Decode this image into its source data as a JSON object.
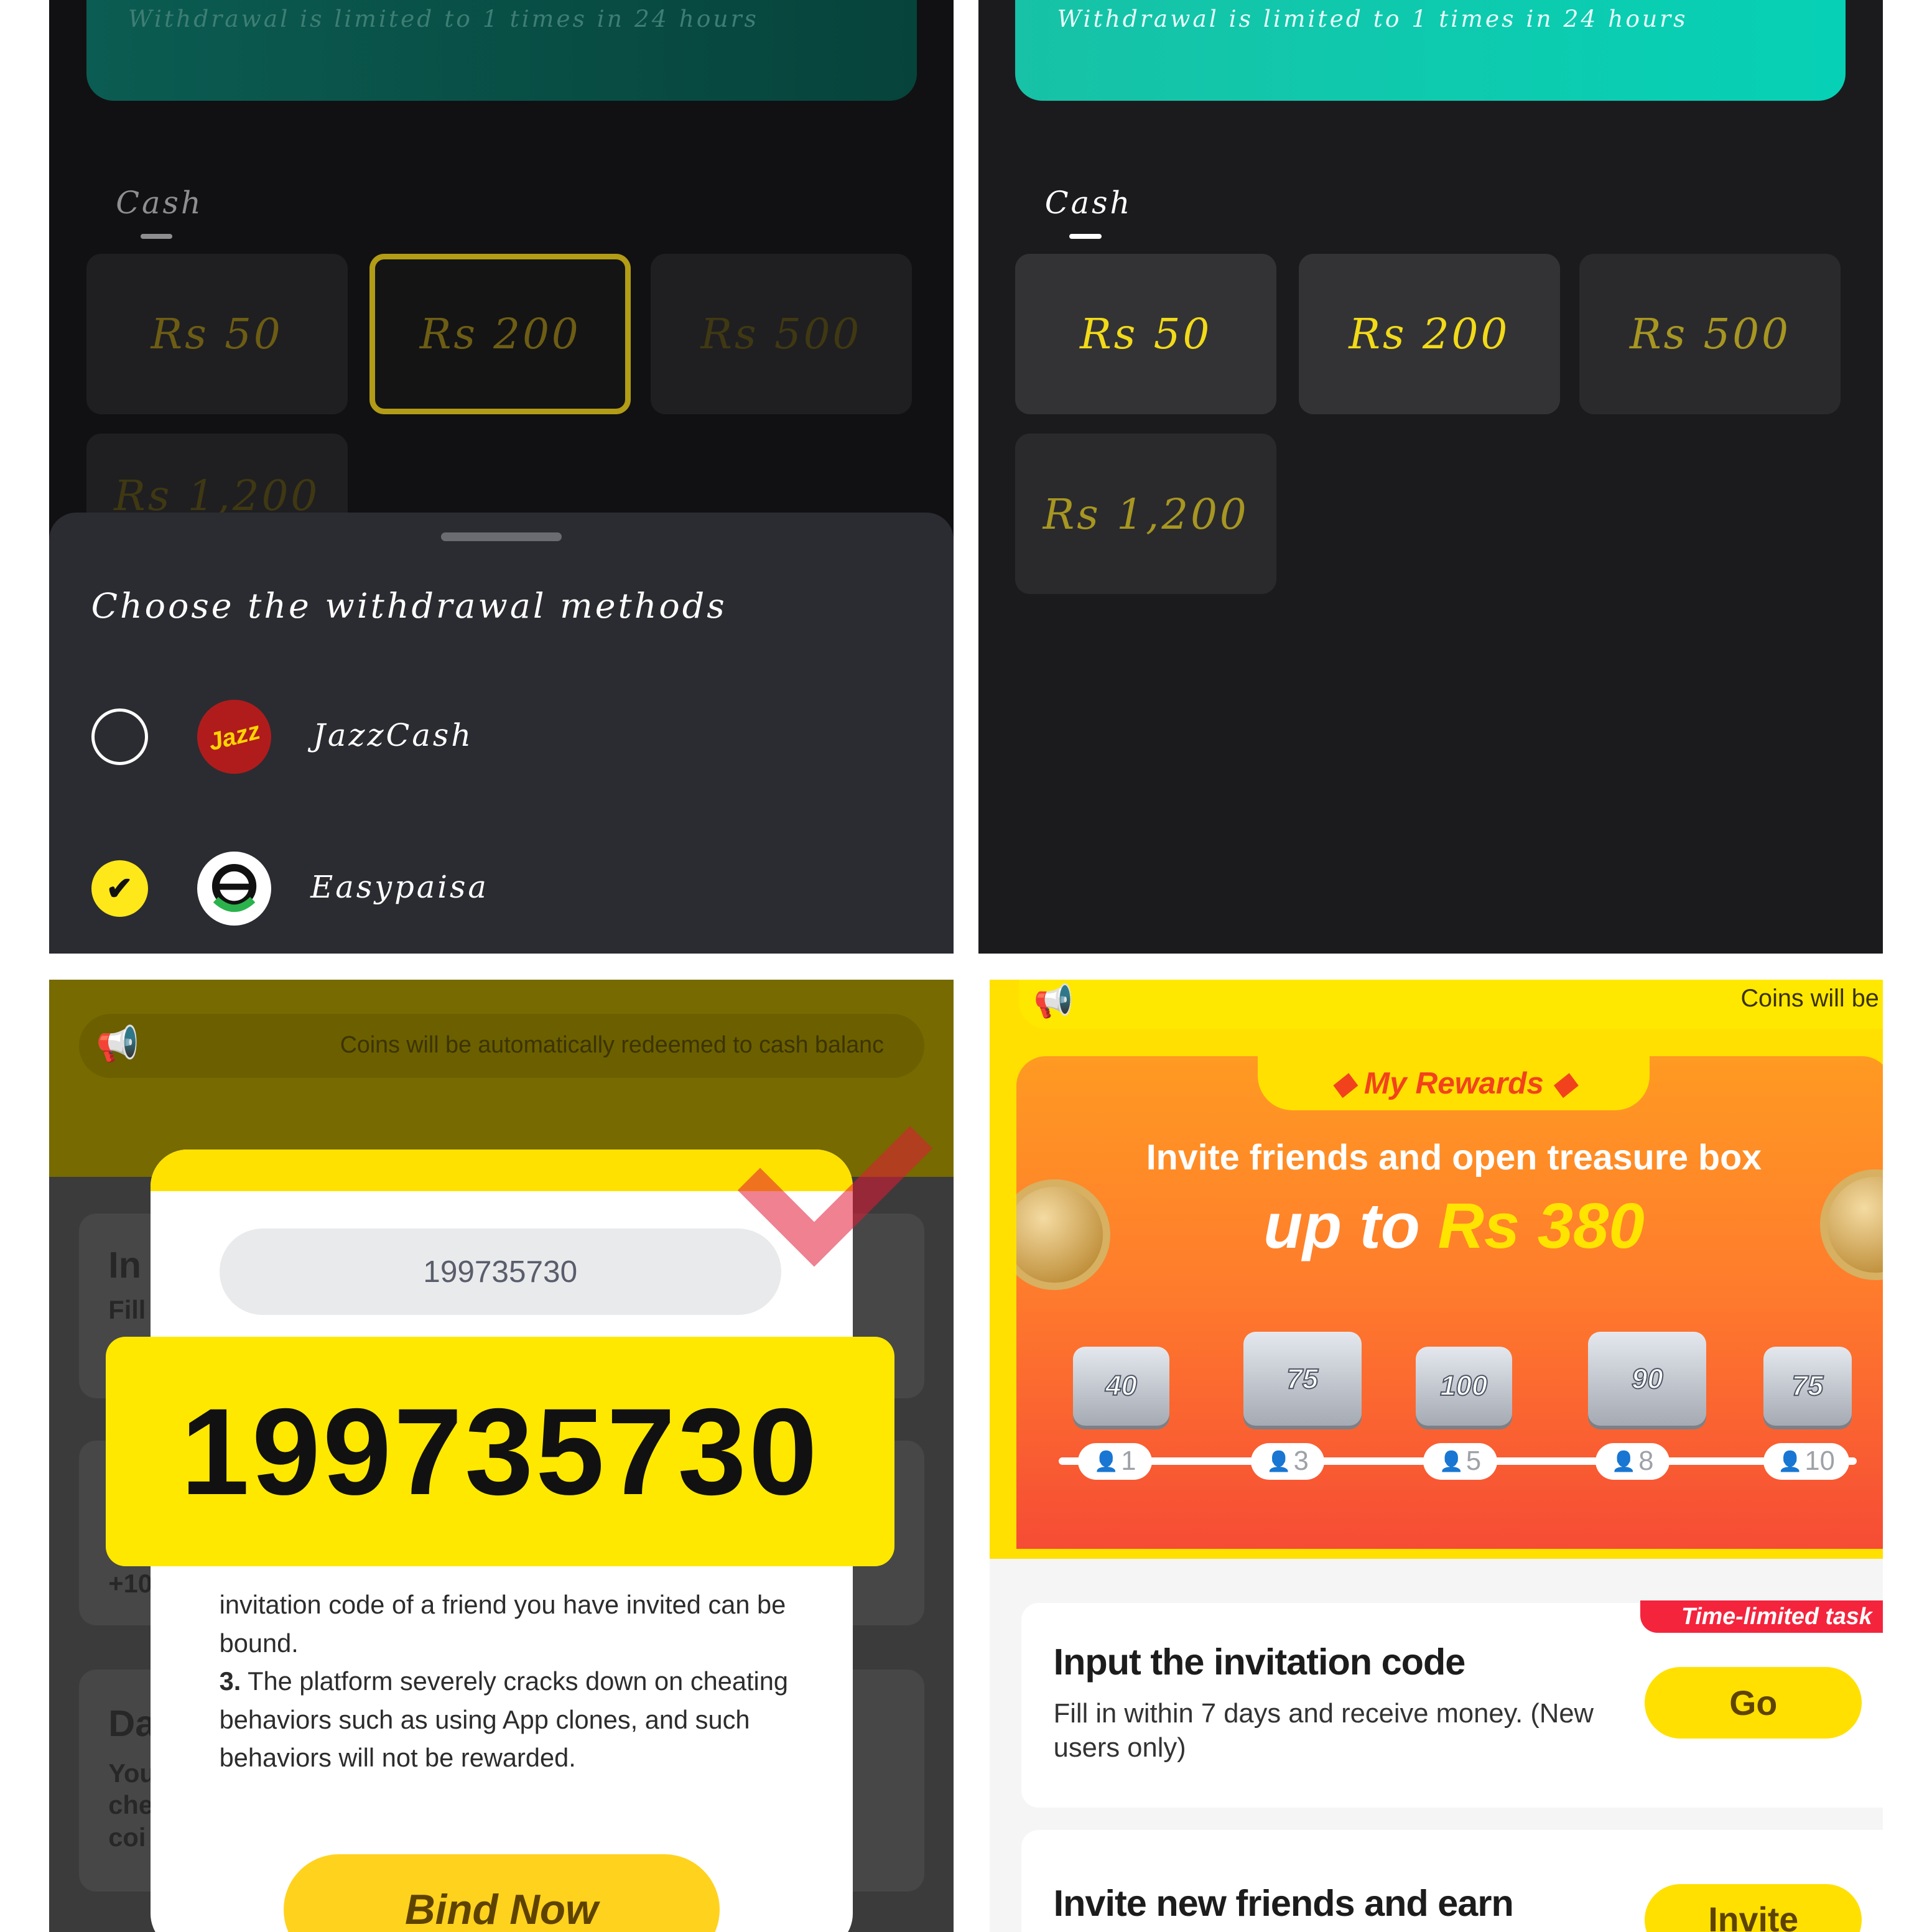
{
  "p1": {
    "banner_text": "Withdrawal is limited to 1 times in 24 hours",
    "tab": "Cash",
    "amounts": [
      "Rs 50",
      "Rs 200",
      "Rs 500",
      "Rs 1,200"
    ],
    "selected_amount": "Rs 200",
    "sheet_title": "Choose the withdrawal methods",
    "methods": [
      {
        "label": "JazzCash",
        "logo_text": "Jazz",
        "selected": false,
        "icon": "jazz-logo"
      },
      {
        "label": "Easypaisa",
        "selected": true,
        "icon": "easypaisa-logo"
      }
    ],
    "check_glyph": "✔"
  },
  "p2": {
    "banner_text": "Withdrawal is limited to 1 times in 24 hours",
    "tab": "Cash",
    "amounts": [
      "Rs 50",
      "Rs 200",
      "Rs 500",
      "Rs 1,200"
    ]
  },
  "p3": {
    "notice": "Coins will be automatically redeemed to cash balanc",
    "speaker_glyph": "📢",
    "code_value": "199735730",
    "code_zoom": "199735730",
    "rules_1": "invitation code of a friend you have invited can be bound.",
    "rules_3_num": "3.",
    "rules_3": "The platform severely cracks down on cheating behaviors such as using App clones, and such behaviors will not be rewarded.",
    "bind_button": "Bind Now",
    "bg_fragments": [
      "In",
      "Fill",
      "+10",
      "Da",
      "You",
      "che",
      "coi"
    ]
  },
  "p4": {
    "notice": "Coins will be",
    "speaker_glyph": "📢",
    "rewards_title": "◆ My Rewards ◆",
    "invite_line": "Invite friends and open treasure box",
    "upto_prefix": "up to",
    "upto_amount": "Rs 380",
    "chests": [
      {
        "value": "40",
        "friends": "1"
      },
      {
        "value": "75",
        "friends": "3"
      },
      {
        "value": "100",
        "friends": "5"
      },
      {
        "value": "90",
        "friends": "8"
      },
      {
        "value": "75",
        "friends": "10"
      }
    ],
    "person_glyph": "👤",
    "task1": {
      "ribbon": "Time-limited task",
      "title": "Input the invitation code",
      "desc": "Fill in within 7 days and receive money. (New users only)",
      "button": "Go"
    },
    "task2": {
      "title": "Invite new friends and earn",
      "button": "Invite"
    },
    "colors": {
      "accent_yellow": "#ffe000",
      "reward_orange": "#ff7d2c",
      "ribbon_red": "#f4243d"
    }
  }
}
